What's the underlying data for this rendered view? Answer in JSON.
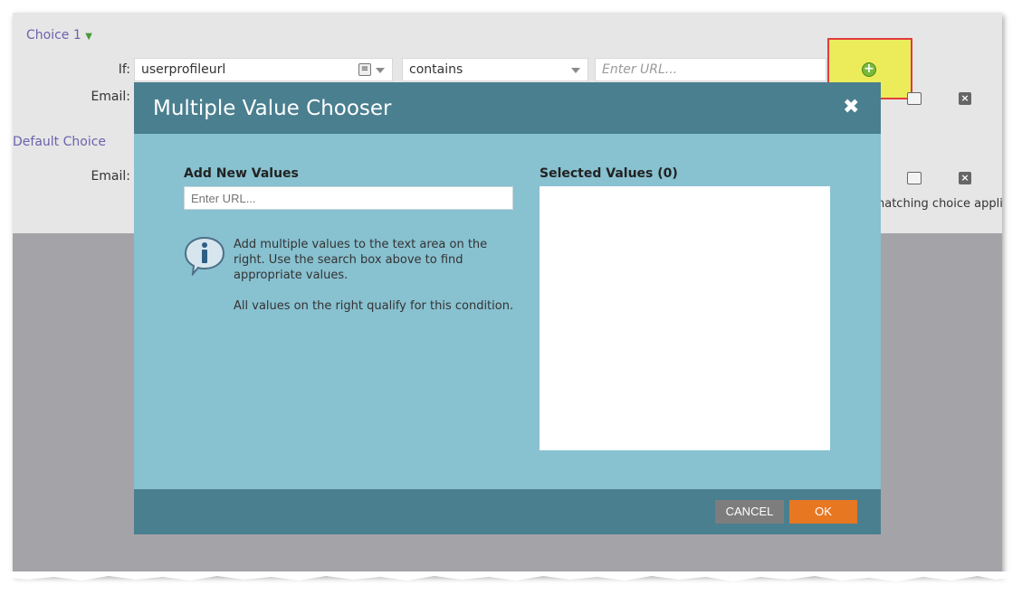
{
  "choice": {
    "title": "Choice 1",
    "if_label": "If:",
    "field_value": "userprofileurl",
    "operator_value": "contains",
    "url_placeholder": "Enter URL...",
    "email_label": "Email:"
  },
  "default_choice": {
    "title": "Default Choice",
    "email_label": "Email:",
    "note": "hatching choice applies"
  },
  "modal": {
    "title": "Multiple Value Chooser",
    "close_glyph": "✖",
    "add_new_title": "Add New Values",
    "add_new_placeholder": "Enter URL...",
    "info_line1": "Add multiple values to the text area on the right. Use the search box above to find appropriate values.",
    "info_line2": "All values on the right qualify for this condition.",
    "selected_title": "Selected Values (0)",
    "cancel_label": "CANCEL",
    "ok_label": "OK"
  },
  "colors": {
    "accent_link": "#6b62ad",
    "modal_header": "#4a7f8f",
    "modal_body": "#88c1d0",
    "ok_button": "#e87722",
    "cancel_button": "#7d7d7d",
    "highlight": "#ecec5a",
    "highlight_border": "#e13c3c"
  }
}
